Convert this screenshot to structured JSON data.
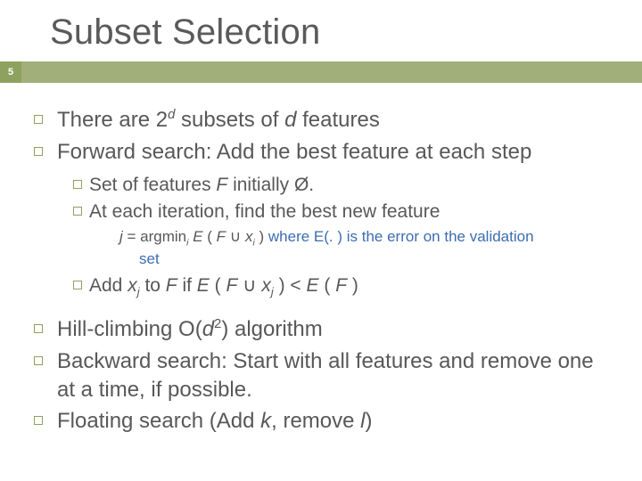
{
  "page_number": "5",
  "title": "Subset Selection",
  "b1_pre": "There are 2",
  "b1_sup": "d",
  "b1_mid": " subsets of ",
  "b1_d": "d",
  "b1_post": " features",
  "b2": "Forward search: Add the best feature at each step",
  "s1_pre": "Set of features ",
  "s1_F": "F",
  "s1_post": " initially Ø.",
  "s2": "At each iteration, find the best new feature",
  "f_j": "j",
  "f_eq": " = argmin",
  "f_i": "i",
  "f_sp": " ",
  "f_E": "E",
  "f_op": " ( ",
  "f_Fa": "F",
  "f_cup": " ∪ ",
  "f_xi_x": "x",
  "f_xi_i": "i",
  "f_cl": " )",
  "f_blue": " where E(. ) is the error on the validation",
  "f_set": "set",
  "s3_pre": "Add ",
  "s3_x": "x",
  "s3_j": "j",
  "s3_to": " to  ",
  "s3_F1": "F",
  "s3_if": "  if ",
  "s3_E1": "E",
  "s3_op2": " ( ",
  "s3_F2": "F",
  "s3_cup2": " ∪ ",
  "s3_x2": "x",
  "s3_j2": "j",
  "s3_cl2": " ) < ",
  "s3_E2": "E",
  "s3_op3": " ( ",
  "s3_F3": "F",
  "s3_cl3": " )",
  "b3_pre": "Hill-climbing O(",
  "b3_d": "d",
  "b3_sup2": "2",
  "b3_post": ") algorithm",
  "b4": "Backward search: Start with all features and remove   one at a time, if possible.",
  "b5_pre": "Floating search (Add ",
  "b5_k": "k",
  "b5_mid": ", remove ",
  "b5_l": "l",
  "b5_post": ")"
}
